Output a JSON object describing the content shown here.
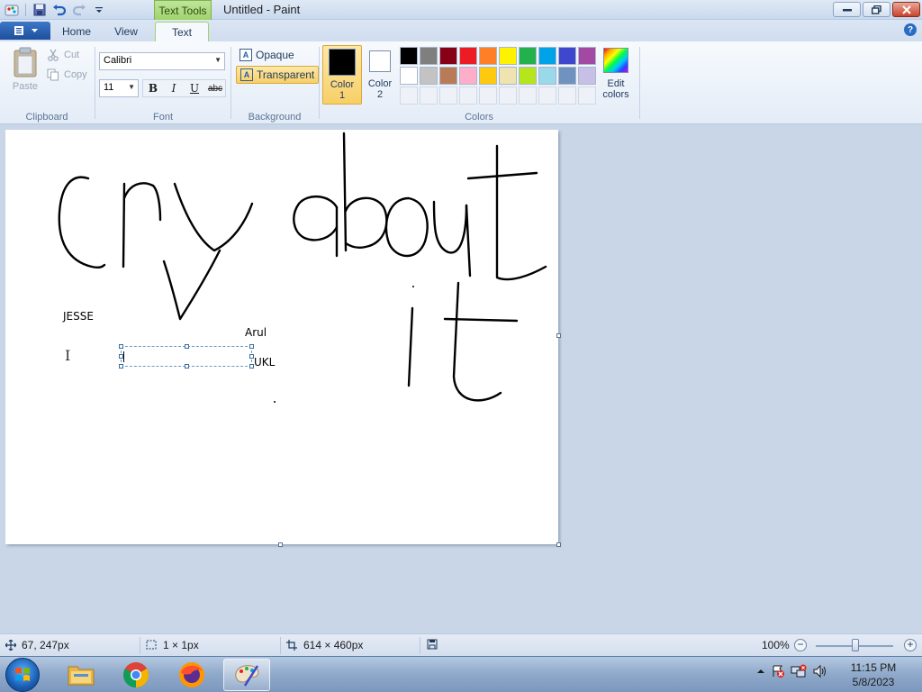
{
  "window": {
    "title": "Untitled - Paint",
    "context_tab_title": "Text Tools"
  },
  "tabs": [
    {
      "label": "Home"
    },
    {
      "label": "View"
    },
    {
      "label": "Text"
    }
  ],
  "clipboard": {
    "paste_label": "Paste",
    "cut_label": "Cut",
    "copy_label": "Copy",
    "group_label": "Clipboard"
  },
  "font": {
    "family": "Calibri",
    "size": "11",
    "bold": "B",
    "italic": "I",
    "underline": "U",
    "strikethrough": "abc",
    "group_label": "Font"
  },
  "background": {
    "opaque_label": "Opaque",
    "transparent_label": "Transparent",
    "selected": "Transparent",
    "group_label": "Background"
  },
  "colors": {
    "color1_label": "Color 1",
    "color2_label": "Color 2",
    "color1": "#000000",
    "color2": "#ffffff",
    "edit_label": "Edit colors",
    "group_label": "Colors",
    "palette_row1": [
      "#000000",
      "#7f7f7f",
      "#880015",
      "#ed1c24",
      "#ff7f27",
      "#fff200",
      "#22b14c",
      "#00a2e8",
      "#3f48cc",
      "#a349a4"
    ],
    "palette_row2": [
      "#ffffff",
      "#c3c3c3",
      "#b97a57",
      "#ffaec9",
      "#ffc90e",
      "#efe4b0",
      "#b5e61d",
      "#99d9ea",
      "#7092be",
      "#c8bfe7"
    ]
  },
  "canvas": {
    "texts": {
      "jesse": "JESSE",
      "arul": "Arul",
      "ukl": "UKL"
    }
  },
  "status": {
    "cursor_pos": "67, 247px",
    "selection_size": "1 × 1px",
    "image_size": "614 × 460px",
    "zoom": "100%"
  },
  "taskbar": {
    "time": "11:15 PM",
    "date": "5/8/2023"
  }
}
